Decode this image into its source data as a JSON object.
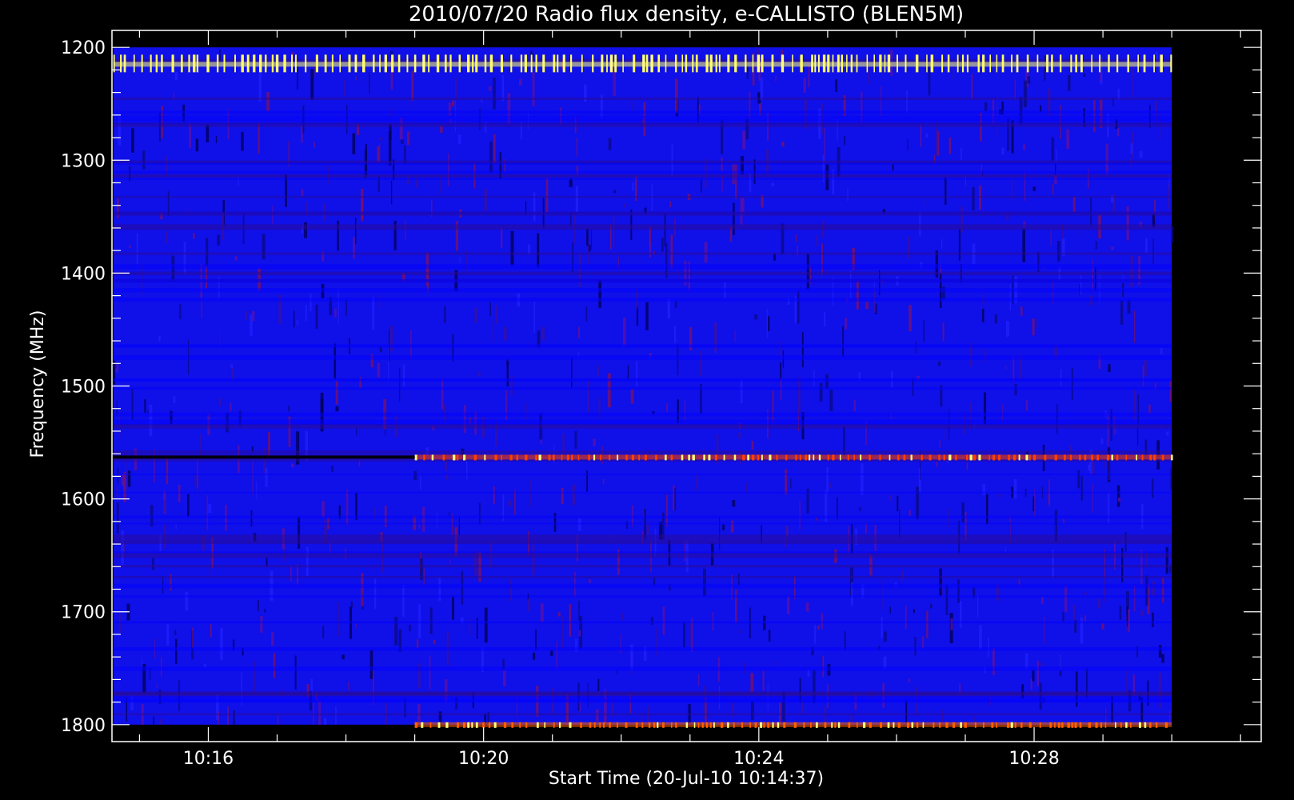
{
  "chart_data": {
    "type": "heatmap",
    "title": "2010/07/20  Radio flux density, e-CALLISTO (BLEN5M)",
    "xlabel": "Start Time (20-Jul-10 10:14:37)",
    "ylabel": "Frequency (MHz)",
    "x_ticks": [
      "10:16",
      "10:20",
      "10:24",
      "10:28"
    ],
    "x_tick_minutes": [
      16,
      20,
      24,
      28
    ],
    "xlim_minutes": [
      14.6,
      31.3
    ],
    "data_x_range_minutes": [
      14.62,
      30.0
    ],
    "y_ticks": [
      1200,
      1300,
      1400,
      1500,
      1600,
      1700,
      1800
    ],
    "ylim": [
      1185,
      1815
    ],
    "ylim_inverted": true,
    "data_y_range": [
      1200,
      1800
    ],
    "background_color": "#0000ff",
    "features": [
      {
        "name": "interference band",
        "frequency": 1215,
        "x_range_minutes": [
          14.62,
          30.0
        ],
        "color": "#ffff66"
      },
      {
        "name": "interference band",
        "frequency": 1563,
        "x_range_minutes": [
          19.0,
          30.0
        ],
        "color": "#ff4000"
      },
      {
        "name": "interference band",
        "frequency": 1800,
        "x_range_minutes": [
          19.0,
          30.0
        ],
        "color": "#ff6000"
      }
    ]
  }
}
